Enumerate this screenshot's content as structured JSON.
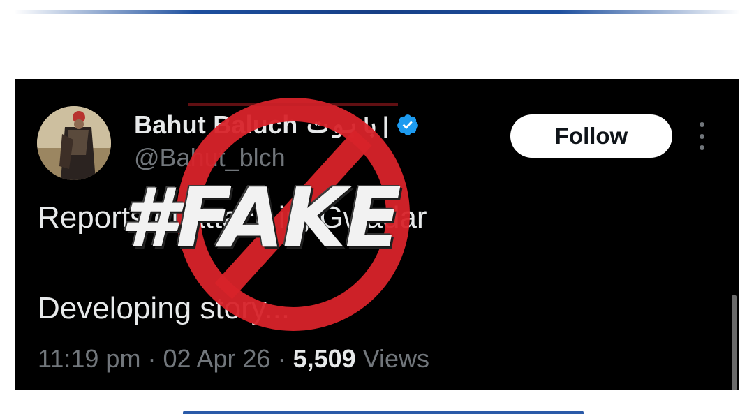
{
  "tweet": {
    "display_name": "Bahut Baluch",
    "display_name_urdu": "| با ہوت",
    "handle": "@Bahut_blch",
    "follow_label": "Follow",
    "line1": "Reports of attack in, Gwadar",
    "line2": "Developing story...",
    "time": "11:19 pm",
    "separator": " · ",
    "date": "02 Apr 26",
    "views_count": "5,509",
    "views_label": " Views"
  },
  "overlay": {
    "stamp_text": "#FAKE",
    "stamp_icon": "prohibited-sign-icon",
    "stamp_color": "#d8232a"
  },
  "colors": {
    "verified": "#1d9bf0",
    "background": "#000000",
    "text": "#e7e9ea",
    "muted": "#71767b",
    "rule": "#1d4f9e"
  }
}
